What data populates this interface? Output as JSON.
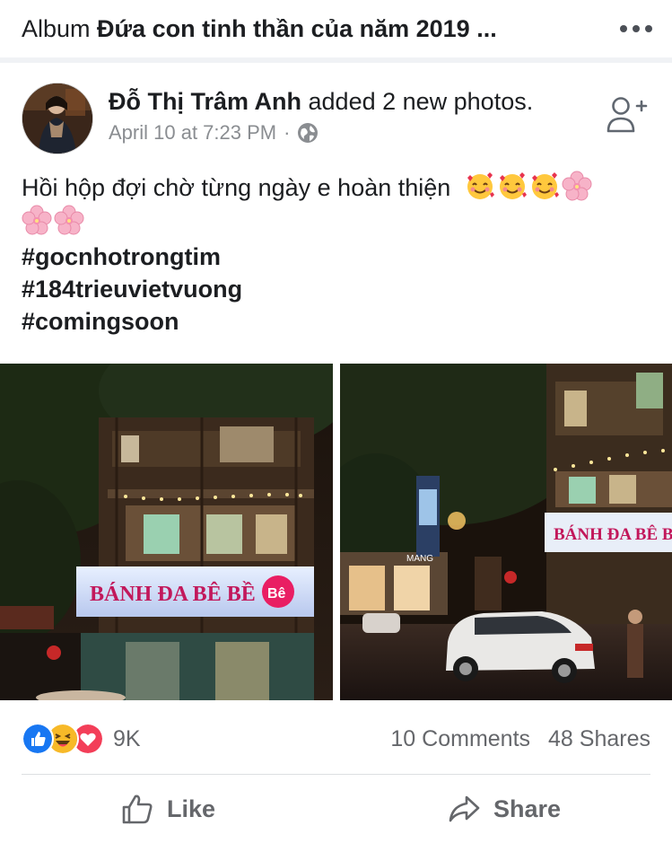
{
  "header": {
    "album_prefix": "Album",
    "album_name": "Đứa con tinh thần của năm 2019 ...",
    "more_icon": "more-horizontal-icon"
  },
  "post": {
    "author": "Đỗ Thị Trâm Anh",
    "action": "added 2 new photos.",
    "timestamp": "April 10 at 7:23 PM",
    "separator": "·",
    "privacy_icon": "globe-icon",
    "add_friend_icon": "add-friend-icon",
    "text": "Hồi hộp đợi chờ từng ngày e hoàn thiện",
    "emojis_line1": [
      "smiling-face-with-hearts",
      "smiling-face-with-hearts",
      "smiling-face-with-hearts",
      "cherry-blossom"
    ],
    "emojis_line2": [
      "cherry-blossom",
      "cherry-blossom"
    ],
    "hashtags": [
      "#gocnhotrongtim",
      "#184trieuvietvuong",
      "#comingsoon"
    ]
  },
  "photos": [
    {
      "sign_text": "BÁNH ĐA BÊ BỀ",
      "logo_text": "Bê"
    },
    {
      "sign_text": "BÁNH ĐA BÊ B",
      "side_text": "MANG"
    }
  ],
  "stats": {
    "reaction_icons": [
      "like-icon",
      "haha-icon",
      "love-icon"
    ],
    "reaction_count": "9K",
    "comments": "10 Comments",
    "shares": "48 Shares"
  },
  "actions": {
    "like_label": "Like",
    "share_label": "Share"
  },
  "colors": {
    "like_blue": "#1877f2",
    "haha_yellow": "#f7b928",
    "love_red": "#f33e58",
    "muted_text": "#65676b"
  }
}
